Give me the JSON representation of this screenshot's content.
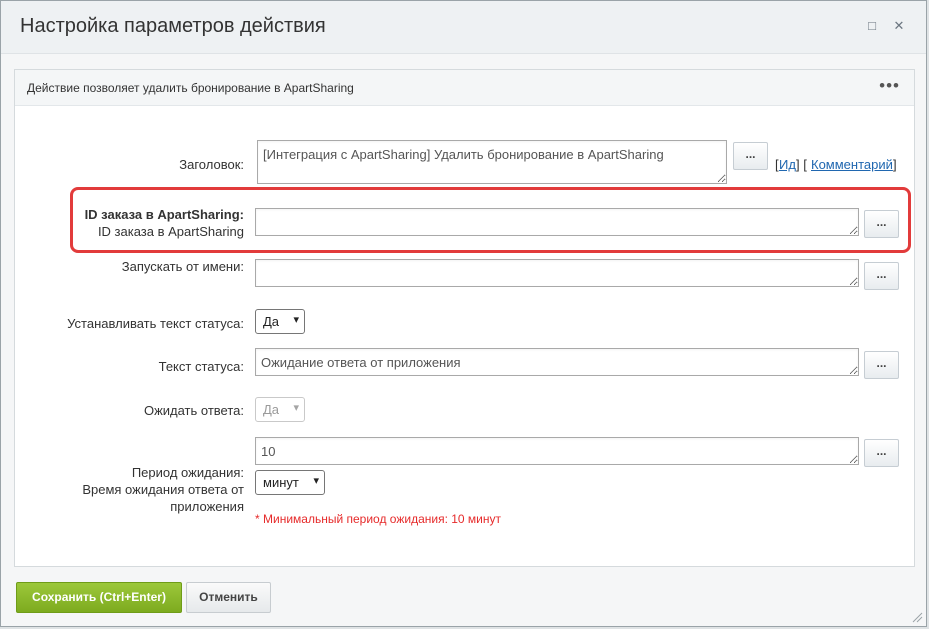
{
  "window": {
    "title": "Настройка параметров действия",
    "maximize_glyph": "□",
    "close_glyph": "✕"
  },
  "panel": {
    "description": "Действие позволяет удалить бронирование в ApartSharing",
    "more_glyph": "•••"
  },
  "form": {
    "dots_label": "...",
    "title_field": {
      "label": "Заголовок:",
      "value": "[Интеграция с ApartSharing] Удалить бронирование в ApartSharing",
      "bracket_open": "[",
      "bracket_mid": "] [",
      "bracket_close": "]",
      "id_link": "Ид",
      "comment_link": "Комментарий"
    },
    "order_id": {
      "label_bold": "ID заказа в ApartSharing:",
      "label_sub": "ID заказа в ApartSharing",
      "value": ""
    },
    "run_as": {
      "label": "Запускать от имени:",
      "value": ""
    },
    "set_status_text": {
      "label": "Устанавливать текст статуса:",
      "selected": "Да"
    },
    "status_text": {
      "label": "Текст статуса:",
      "value": "Ожидание ответа от приложения"
    },
    "wait_response": {
      "label": "Ожидать ответа:",
      "selected": "Да"
    },
    "wait_period": {
      "label_line1": "Период ожидания:",
      "label_line2": "Время ожидания ответа от",
      "label_line3": "приложения",
      "value": "10",
      "unit_selected": "минут",
      "hint": "* Минимальный период ожидания: 10 минут"
    }
  },
  "footer": {
    "save_label": "Сохранить (Ctrl+Enter)",
    "cancel_label": "Отменить"
  },
  "colors": {
    "highlight_border": "#e23b3b",
    "save_button": "#8cbb2a",
    "link": "#2067b0",
    "hint": "#e62a2a"
  },
  "icons": {
    "chevron": "chevron-down-icon",
    "resize": "resize-grip-icon"
  }
}
